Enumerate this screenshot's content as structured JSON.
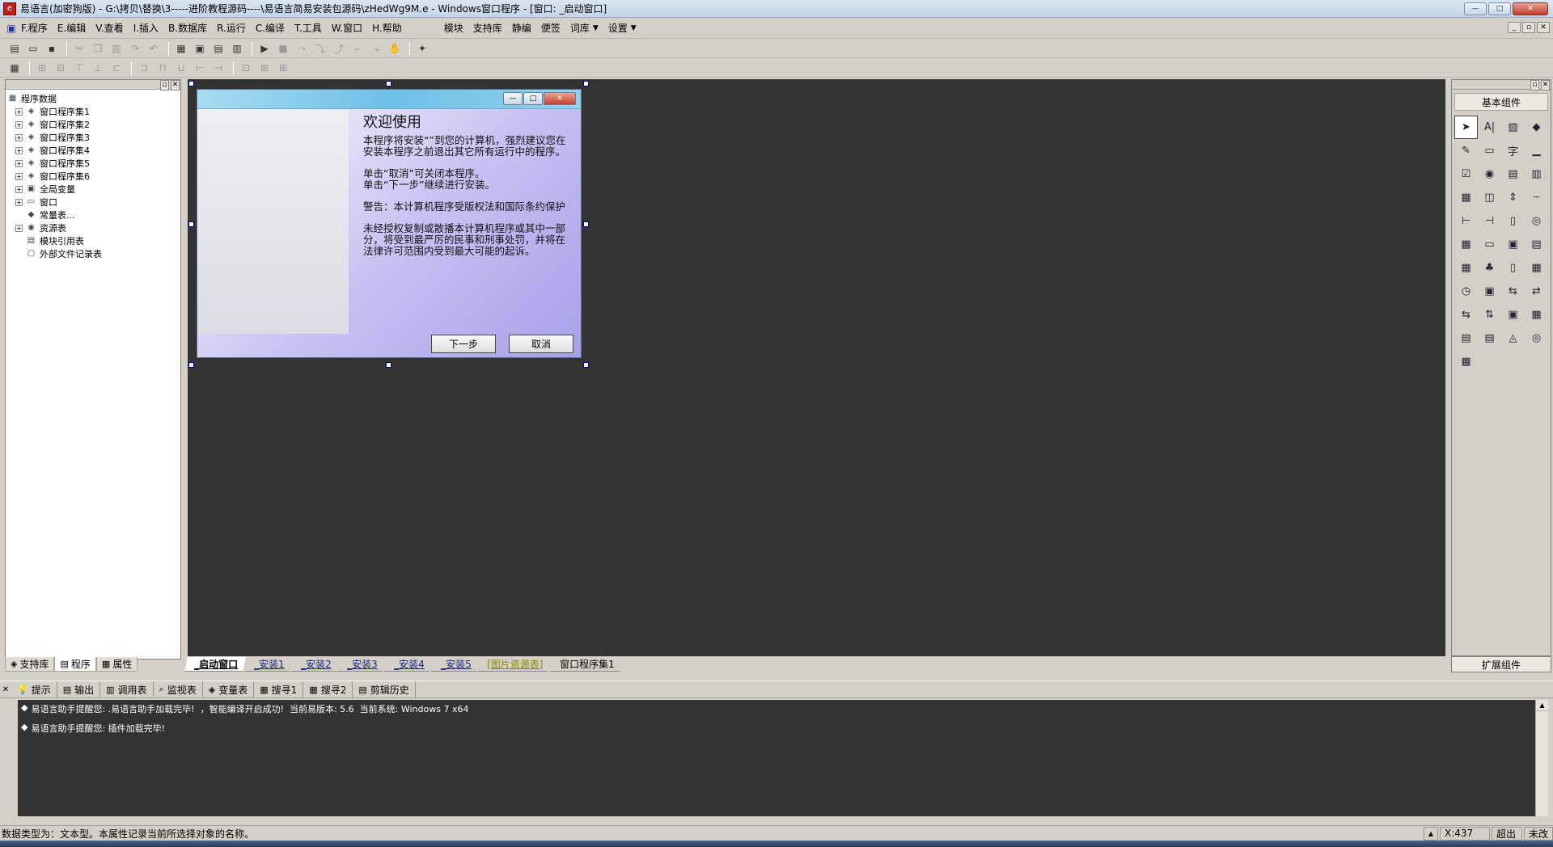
{
  "titlebar": {
    "icon": "e",
    "title": "易语言(加密狗版) - G:\\拷贝\\替换\\3-----进阶教程源码----\\易语言简易安装包源码\\zHedWg9M.e - Windows窗口程序 - [窗口: _启动窗口]",
    "min": "—",
    "max": "□",
    "close": "✕"
  },
  "menu": {
    "items": [
      "F.程序",
      "E.编辑",
      "V.查看",
      "I.插入",
      "B.数据库",
      "R.运行",
      "C.编译",
      "T.工具",
      "W.窗口",
      "H.帮助"
    ],
    "extras": [
      "模块",
      "支持库",
      "静编",
      "便签",
      "词库",
      "设置"
    ],
    "arrow": "▼",
    "mdi": [
      "_",
      "▫",
      "✕"
    ]
  },
  "toolbar1_glyphs": [
    "▤",
    "▭",
    "▪",
    "✂",
    "❐",
    "▥",
    "↷",
    "↶",
    "▦",
    "▣",
    "▤",
    "▥",
    "▶",
    "■",
    "⤳",
    "⤵",
    "⤴",
    "⤶",
    "⤷",
    "✋",
    "✦"
  ],
  "toolbar2_glyphs": [
    "▦",
    "⊞",
    "⊟",
    "⊤",
    "⊥",
    "⊏",
    "⊐",
    "⊓",
    "⊔",
    "⊢",
    "⊣",
    "⊡",
    "⊠",
    "⊞"
  ],
  "left_panel": {
    "head_buttons": [
      "▫",
      "✕"
    ],
    "tree": [
      {
        "label": "程序数据",
        "toggle": "",
        "icon": "▦",
        "indent": 0
      },
      {
        "label": "窗口程序集1",
        "toggle": "+",
        "icon": "◈",
        "indent": 1
      },
      {
        "label": "窗口程序集2",
        "toggle": "+",
        "icon": "◈",
        "indent": 1
      },
      {
        "label": "窗口程序集3",
        "toggle": "+",
        "icon": "◈",
        "indent": 1
      },
      {
        "label": "窗口程序集4",
        "toggle": "+",
        "icon": "◈",
        "indent": 1
      },
      {
        "label": "窗口程序集5",
        "toggle": "+",
        "icon": "◈",
        "indent": 1
      },
      {
        "label": "窗口程序集6",
        "toggle": "+",
        "icon": "◈",
        "indent": 1
      },
      {
        "label": "全局变量",
        "toggle": "+",
        "icon": "▣",
        "indent": 1
      },
      {
        "label": "窗口",
        "toggle": "+",
        "icon": "▭",
        "indent": 1
      },
      {
        "label": "常量表...",
        "toggle": "",
        "icon": "◆",
        "indent": 1
      },
      {
        "label": "资源表",
        "toggle": "+",
        "icon": "◉",
        "indent": 1
      },
      {
        "label": "模块引用表",
        "toggle": "",
        "icon": "▤",
        "indent": 1
      },
      {
        "label": "外部文件记录表",
        "toggle": "",
        "icon": "▢",
        "indent": 1
      }
    ],
    "tabs": [
      {
        "label": "支持库",
        "icon": "◈"
      },
      {
        "label": "程序",
        "icon": "▤"
      },
      {
        "label": "属性",
        "icon": "▦"
      }
    ]
  },
  "form": {
    "title_buttons": [
      "—",
      "□",
      "✕"
    ],
    "heading": "欢迎使用",
    "paragraphs": [
      "本程序将安装“”到您的计算机，强烈建议您在安装本程序之前退出其它所有运行中的程序。",
      "单击“取消”可关闭本程序。\n单击“下一步”继续进行安装。",
      "警告：本计算机程序受版权法和国际条约保护",
      "未经授权复制或散播本计算机程序或其中一部分，将受到最严厉的民事和刑事处罚，并将在法律许可范围内受到最大可能的起诉。"
    ],
    "next_button": "下一步",
    "cancel_button": "取消"
  },
  "designer_tabs": [
    {
      "label": "_启动窗口",
      "style": "active"
    },
    {
      "label": "_安装1",
      "style": ""
    },
    {
      "label": "_安装2",
      "style": ""
    },
    {
      "label": "_安装3",
      "style": ""
    },
    {
      "label": "_安装4",
      "style": ""
    },
    {
      "label": "_安装5",
      "style": ""
    },
    {
      "label": "[图片资源表]",
      "style": "olive"
    },
    {
      "label": "窗口程序集1",
      "style": "plain"
    }
  ],
  "right_panel": {
    "head_buttons": [
      "▫",
      "✕"
    ],
    "title": "基本组件",
    "footer": "扩展组件",
    "components": [
      "➤",
      "A|",
      "▨",
      "◆",
      "✎",
      "▭",
      "字",
      "▁",
      "☑",
      "◉",
      "▤",
      "▥",
      "▦",
      "◫",
      "⇕",
      "┄",
      "⊢",
      "⊣",
      "▯",
      "◎",
      "▦",
      "▭",
      "▣",
      "▤",
      "▦",
      "♣",
      "▯",
      "▦",
      "◷",
      "▣",
      "⇆",
      "⇄",
      "⇆",
      "⇅",
      "▣",
      "▦",
      "▤",
      "▤",
      "◬",
      "◎",
      "▦"
    ]
  },
  "output": {
    "tabs": [
      {
        "label": "提示",
        "icon": "💡"
      },
      {
        "label": "输出",
        "icon": "▤"
      },
      {
        "label": "调用表",
        "icon": "▥"
      },
      {
        "label": "监视表",
        "icon": "⌕"
      },
      {
        "label": "变量表",
        "icon": "◈"
      },
      {
        "label": "搜寻1",
        "icon": "▦"
      },
      {
        "label": "搜寻2",
        "icon": "▦"
      },
      {
        "label": "剪辑历史",
        "icon": "▤"
      }
    ],
    "close": "✕",
    "lines": [
      "易语言助手提醒您: .易语言助手加载完毕!  ，智能编译开启成功!  当前易版本: 5.6  当前系统: Windows 7 x64",
      "易语言助手提醒您: 插件加载完毕!"
    ],
    "bullet": "◆"
  },
  "status": {
    "message": "数据类型为：文本型。本属性记录当前所选择对象的名称。",
    "coord": "X:437",
    "mode": "超出",
    "state": "未改"
  }
}
